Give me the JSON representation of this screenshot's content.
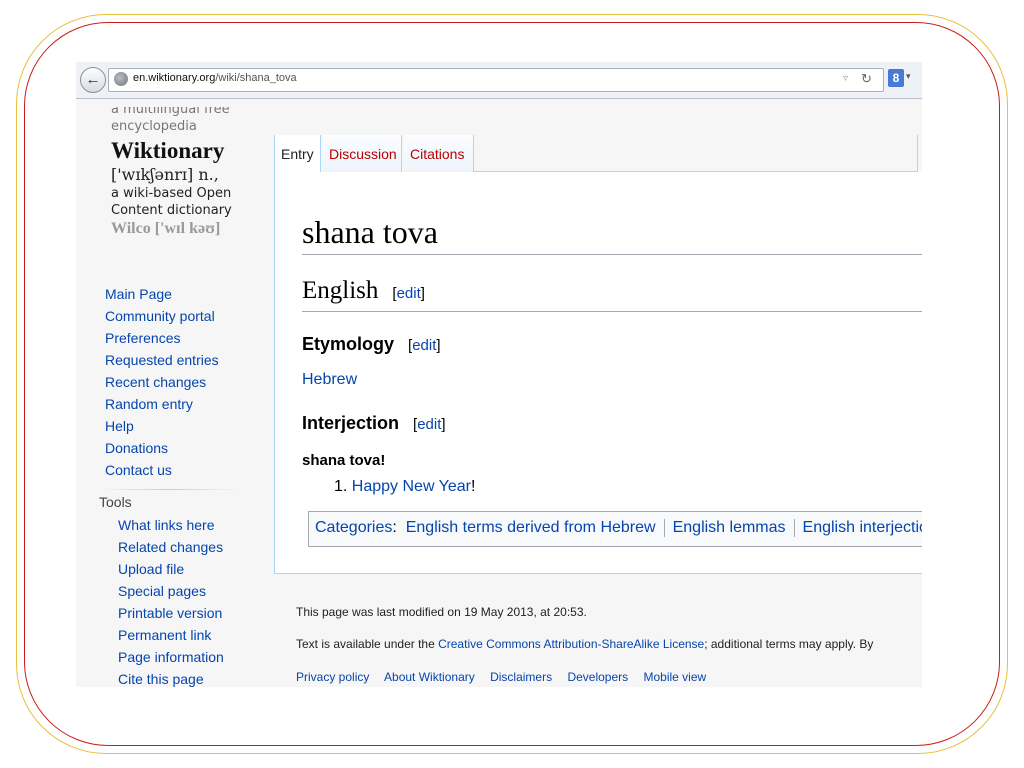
{
  "browser": {
    "url_domain": "en.wiktionary.org",
    "url_path": "/wiki/shana_tova",
    "search_engine_glyph": "8"
  },
  "logo": {
    "tagline": "a multilingual free encyclopedia",
    "title": "Wiktionary",
    "pronunciation": "['wɪkʃənrɪ] n.,",
    "description": "a wiki-based Open Content dictionary",
    "cut_text": "Wilco ['wɪl kəʊ]"
  },
  "sidebar": {
    "nav": [
      "Main Page",
      "Community portal",
      "Preferences",
      "Requested entries",
      "Recent changes",
      "Random entry",
      "Help",
      "Donations",
      "Contact us"
    ],
    "tools_heading": "Tools",
    "tools": [
      "What links here",
      "Related changes",
      "Upload file",
      "Special pages",
      "Printable version",
      "Permanent link",
      "Page information",
      "Cite this page"
    ]
  },
  "tabs": [
    "Entry",
    "Discussion",
    "Citations"
  ],
  "article": {
    "title": "shana tova",
    "language_heading": "English",
    "edit_label": "edit",
    "etymology_heading": "Etymology",
    "etymology_link": "Hebrew",
    "interjection_heading": "Interjection",
    "headword": "shana tova!",
    "definitions": [
      {
        "number": "1.",
        "link": "Happy New Year",
        "suffix": "!"
      }
    ]
  },
  "categories": {
    "label": "Categories",
    "items": [
      "English terms derived from Hebrew",
      "English lemmas",
      "English interjections"
    ]
  },
  "footer": {
    "last_modified": "This page was last modified on 19 May 2013, at 20:53.",
    "license_prefix": "Text is available under the",
    "license_link": "Creative Commons Attribution-ShareAlike License",
    "license_suffix": "; additional terms may apply. By",
    "links": [
      "Privacy policy",
      "About Wiktionary",
      "Disclaimers",
      "Developers",
      "Mobile view"
    ]
  },
  "colors": {
    "link": "#0645ad",
    "red_link": "#ba0000",
    "frame_gold": "#e8c03a",
    "frame_red": "#cc1a1a"
  }
}
